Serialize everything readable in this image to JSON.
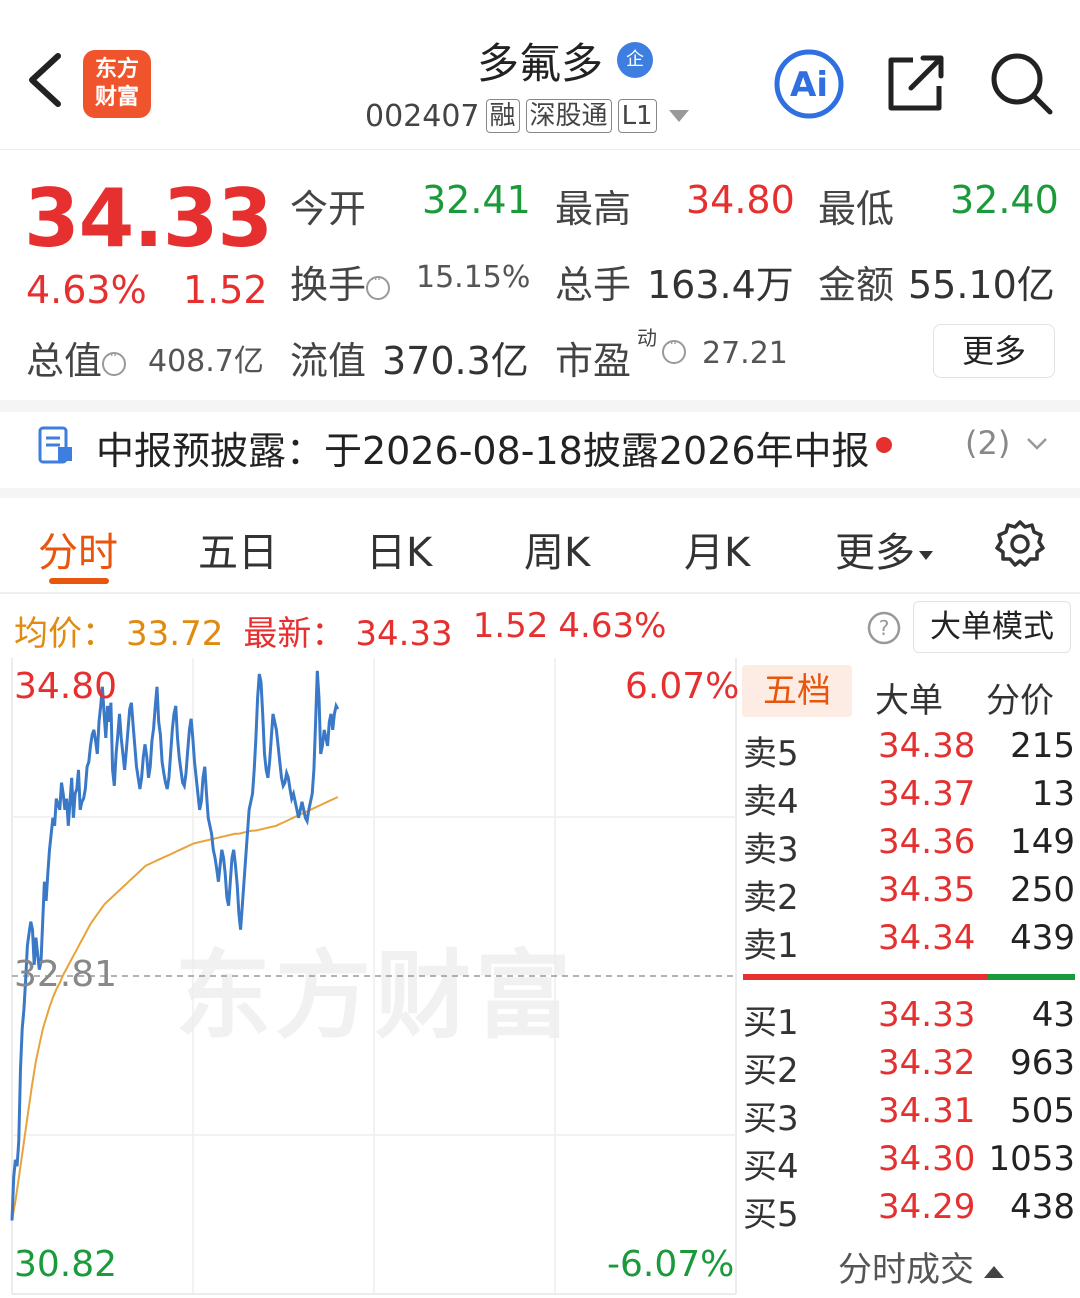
{
  "header": {
    "logo_line1": "东方",
    "logo_line2": "财富",
    "stock_name": "多氟多",
    "badge": "企",
    "code": "002407",
    "tags": [
      "融",
      "深股通",
      "L1"
    ],
    "ai_label": "Ai"
  },
  "quote": {
    "price": "34.33",
    "change_pct": "4.63%",
    "change_val": "1.52",
    "open_label": "今开",
    "open": "32.41",
    "high_label": "最高",
    "high": "34.80",
    "low_label": "最低",
    "low": "32.40",
    "turnover_label": "换手",
    "turnover": "15.15%",
    "volume_label": "总手",
    "volume": "163.4万",
    "amount_label": "金额",
    "amount": "55.10亿",
    "mktcap_label": "总值",
    "mktcap": "408.7亿",
    "float_label": "流值",
    "float": "370.3亿",
    "pe_label": "市盈",
    "pe_sup": "动",
    "pe": "27.21",
    "more_button": "更多"
  },
  "notice": {
    "text": "中报预披露：于2026-08-18披露2026年中报",
    "count": "(2)"
  },
  "tabs": [
    {
      "label": "分时",
      "active": true
    },
    {
      "label": "五日"
    },
    {
      "label": "日K"
    },
    {
      "label": "周K"
    },
    {
      "label": "月K"
    },
    {
      "label": "更多"
    }
  ],
  "avg_row": {
    "avg_label": "均价：",
    "avg": "33.72",
    "latest_label": "最新：",
    "latest": "34.33",
    "chg": "1.52",
    "pct": "4.63%",
    "big_order_button": "大单模式"
  },
  "chart_data": {
    "type": "line",
    "y_max": "34.80",
    "y_min": "30.82",
    "y_mid": "32.81",
    "pct_max": "6.07%",
    "pct_min": "-6.07%",
    "ylim": [
      30.82,
      34.8
    ],
    "prev_close": 32.81,
    "watermark": "东方财富",
    "total_minutes": 241,
    "series": [
      {
        "name": "price",
        "color": "#3a78c8",
        "values": [
          31.28,
          31.55,
          31.66,
          31.62,
          31.78,
          32.23,
          32.48,
          32.6,
          32.78,
          33.0,
          33.08,
          33.15,
          33.1,
          32.88,
          33.05,
          32.95,
          32.85,
          32.9,
          33.15,
          33.4,
          33.28,
          33.45,
          33.6,
          33.7,
          33.8,
          33.75,
          33.92,
          33.88,
          33.85,
          34.02,
          33.95,
          33.85,
          33.92,
          33.75,
          33.9,
          34.05,
          33.8,
          33.95,
          33.98,
          34.1,
          33.85,
          33.9,
          33.92,
          33.98,
          34.12,
          34.15,
          34.25,
          34.32,
          34.35,
          34.28,
          34.2,
          34.4,
          34.5,
          34.62,
          34.45,
          34.3,
          34.5,
          34.4,
          34.52,
          34.1,
          34.0,
          34.2,
          34.32,
          34.45,
          34.3,
          34.2,
          34.1,
          34.22,
          34.35,
          34.48,
          34.52,
          34.38,
          34.25,
          34.12,
          34.05,
          33.98,
          34.05,
          34.18,
          34.26,
          34.18,
          34.05,
          34.12,
          34.28,
          34.36,
          34.5,
          34.62,
          34.4,
          34.32,
          34.15,
          34.08,
          34.02,
          33.98,
          34.05,
          34.2,
          34.35,
          34.45,
          34.5,
          34.3,
          34.18,
          34.1,
          34.02,
          34.0,
          34.08,
          34.22,
          34.35,
          34.42,
          34.3,
          34.15,
          34.05,
          33.95,
          33.85,
          33.9,
          34.05,
          34.12,
          33.95,
          33.8,
          33.75,
          33.7,
          33.6,
          33.55,
          33.48,
          33.4,
          33.5,
          33.6,
          33.55,
          33.45,
          33.3,
          33.25,
          33.4,
          33.55,
          33.6,
          33.5,
          33.38,
          33.2,
          33.1,
          33.25,
          33.4,
          33.55,
          33.7,
          33.85,
          33.9,
          33.95,
          34.1,
          34.3,
          34.55,
          34.7,
          34.65,
          34.45,
          34.2,
          34.1,
          34.05,
          34.15,
          34.3,
          34.45,
          34.4,
          34.35,
          34.25,
          34.15,
          34.05,
          34.0,
          34.02,
          34.08,
          34.05,
          33.98,
          33.92,
          33.95,
          33.9,
          33.85,
          33.8,
          33.85,
          33.9,
          33.85,
          33.8,
          33.78,
          33.85,
          33.9,
          33.95,
          34.1,
          34.4,
          34.72,
          34.55,
          34.2,
          34.25,
          34.35,
          34.3,
          34.25,
          34.4,
          34.45,
          34.35,
          34.45,
          34.5,
          34.48
        ]
      },
      {
        "name": "avg",
        "color": "#e8a33a",
        "values": [
          31.28,
          31.4,
          31.55,
          31.7,
          31.85,
          32.0,
          32.15,
          32.28,
          32.38,
          32.48,
          32.55,
          32.62,
          32.68,
          32.73,
          32.77,
          32.82,
          32.86,
          32.9,
          32.94,
          32.98,
          33.02,
          33.06,
          33.1,
          33.14,
          33.17,
          33.2,
          33.23,
          33.26,
          33.28,
          33.3,
          33.32,
          33.34,
          33.36,
          33.38,
          33.4,
          33.42,
          33.44,
          33.46,
          33.48,
          33.5,
          33.51,
          33.52,
          33.53,
          33.54,
          33.55,
          33.56,
          33.57,
          33.58,
          33.59,
          33.6,
          33.61,
          33.62,
          33.63,
          33.64,
          33.645,
          33.65,
          33.655,
          33.66,
          33.665,
          33.67,
          33.675,
          33.68,
          33.685,
          33.69,
          33.695,
          33.7,
          33.7,
          33.705,
          33.71,
          33.715,
          33.72,
          33.72,
          33.725,
          33.73,
          33.735,
          33.74,
          33.745,
          33.75,
          33.76,
          33.77,
          33.78,
          33.79,
          33.8,
          33.81,
          33.82,
          33.83,
          33.84,
          33.85,
          33.86,
          33.87,
          33.88,
          33.89,
          33.9,
          33.91,
          33.92,
          33.93
        ]
      }
    ]
  },
  "order_book": {
    "tabs": [
      "五档",
      "大单",
      "分价"
    ],
    "asks": [
      {
        "label": "卖5",
        "price": "34.38",
        "vol": "215"
      },
      {
        "label": "卖4",
        "price": "34.37",
        "vol": "13"
      },
      {
        "label": "卖3",
        "price": "34.36",
        "vol": "149"
      },
      {
        "label": "卖2",
        "price": "34.35",
        "vol": "250"
      },
      {
        "label": "卖1",
        "price": "34.34",
        "vol": "439"
      }
    ],
    "bids": [
      {
        "label": "买1",
        "price": "34.33",
        "vol": "43"
      },
      {
        "label": "买2",
        "price": "34.32",
        "vol": "963"
      },
      {
        "label": "买3",
        "price": "34.31",
        "vol": "505"
      },
      {
        "label": "买4",
        "price": "34.30",
        "vol": "1053"
      },
      {
        "label": "买5",
        "price": "34.29",
        "vol": "438"
      }
    ],
    "trades_link": "分时成交"
  }
}
